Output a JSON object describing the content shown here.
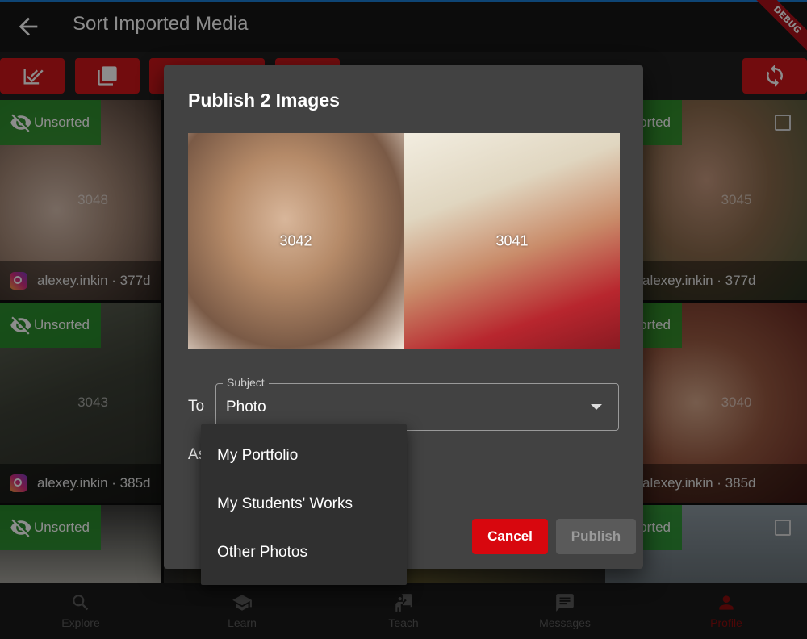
{
  "appbar": {
    "title": "Sort Imported Media",
    "debug_banner": "DEBUG"
  },
  "toolbar": {
    "icons": [
      "select-all-icon",
      "copy-icon",
      "refresh-icon"
    ]
  },
  "grid": {
    "tiles": [
      {
        "number": "3048",
        "tag": "Unsorted",
        "user": "alexey.inkin · 377d"
      },
      {
        "number": "3045",
        "tag": "Unsorted",
        "user": "alexey.inkin · 377d"
      },
      {
        "number": "3043",
        "tag": "Unsorted",
        "user": "alexey.inkin · 385d"
      },
      {
        "number": "3040",
        "tag": "Unsorted",
        "user": "alexey.inkin · 385d"
      },
      {
        "tag": "Unsorted"
      },
      {
        "tag": "Unsorted"
      }
    ]
  },
  "dialog": {
    "title": "Publish 2 Images",
    "previews": [
      {
        "number": "3042"
      },
      {
        "number": "3041"
      }
    ],
    "to_label": "To",
    "as_label": "As",
    "subject": {
      "label": "Subject",
      "value": "Photo"
    },
    "cancel_label": "Cancel",
    "publish_label": "Publish"
  },
  "menu": {
    "items": [
      "My Portfolio",
      "My Students' Works",
      "Other Photos"
    ]
  },
  "bottom_nav": {
    "items": [
      {
        "label": "Explore",
        "icon": "search-icon"
      },
      {
        "label": "Learn",
        "icon": "graduation-cap-icon"
      },
      {
        "label": "Teach",
        "icon": "teacher-icon"
      },
      {
        "label": "Messages",
        "icon": "message-icon"
      },
      {
        "label": "Profile",
        "icon": "person-icon",
        "active": true
      }
    ]
  },
  "colors": {
    "accent": "#d8070e",
    "tag_green": "#239628",
    "active_nav": "#8a0e0e"
  }
}
